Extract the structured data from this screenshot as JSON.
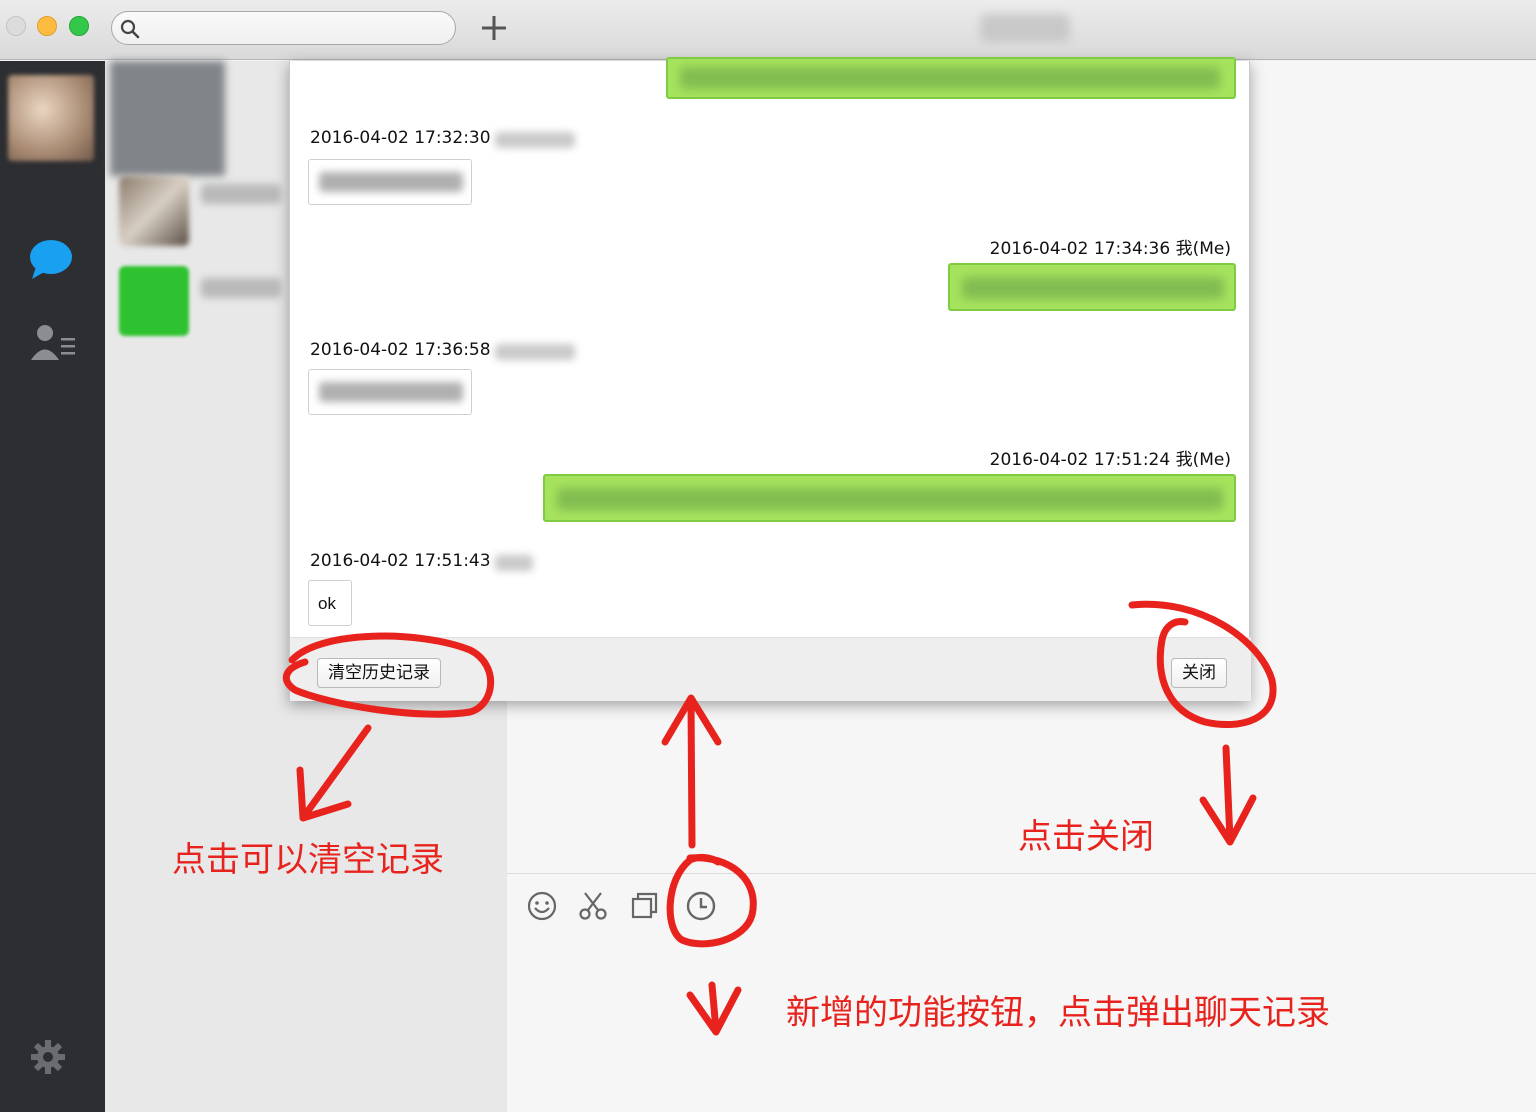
{
  "window": {
    "title": ""
  },
  "search": {
    "placeholder": ""
  },
  "nav": {
    "items": [
      {
        "name": "chats",
        "icon": "chat-bubble-icon"
      },
      {
        "name": "contacts",
        "icon": "contacts-icon"
      },
      {
        "name": "settings",
        "icon": "gear-icon"
      }
    ],
    "accent_color": "#1aa0f0"
  },
  "history": {
    "messages": [
      {
        "direction": "in",
        "timestamp": "2016-04-02 17:32:30",
        "text": ""
      },
      {
        "direction": "out",
        "timestamp": "2016-04-02 17:34:36 我(Me)",
        "text": ""
      },
      {
        "direction": "in",
        "timestamp": "2016-04-02 17:36:58",
        "text": ""
      },
      {
        "direction": "out",
        "timestamp": "2016-04-02 17:51:24 我(Me)",
        "text": ""
      },
      {
        "direction": "in",
        "timestamp": "2016-04-02 17:51:43",
        "text": "ok"
      }
    ],
    "clear_button": "清空历史记录",
    "close_button": "关闭",
    "outgoing_bubble_color": "#a6e35d"
  },
  "toolbar": {
    "tools": [
      {
        "name": "emoji",
        "icon": "smiley-icon"
      },
      {
        "name": "screenshot",
        "icon": "scissors-icon"
      },
      {
        "name": "window-capture",
        "icon": "window-icon"
      },
      {
        "name": "history",
        "icon": "clock-icon"
      }
    ]
  },
  "annotations": {
    "clear_note": "点击可以清空记录",
    "close_note": "点击关闭",
    "new_button_note": "新增的功能按钮，点击弹出聊天记录",
    "color": "#e8231e"
  }
}
